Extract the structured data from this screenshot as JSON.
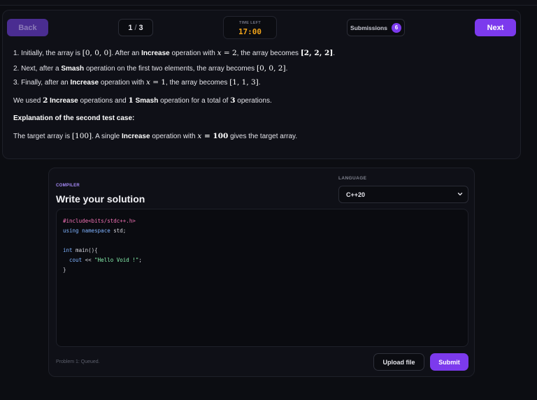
{
  "nav": {
    "back_label": "Back",
    "page_current": "1",
    "page_sep": "/",
    "page_total": "3",
    "time_left_label": "TIME LEFT",
    "time_left_value": "17:00",
    "submissions_label": "Submissions",
    "submissions_count": "6",
    "next_label": "Next"
  },
  "problem": {
    "step1": {
      "a": "1. Initially, the array is ",
      "m1": "[0, 0, 0]",
      "b": ". After an ",
      "op": "Increase",
      "c": " operation with ",
      "var": "x",
      "d": " = 2",
      "e": ", the array becomes ",
      "m2": "[2, 2, 2]",
      "f": "."
    },
    "step2": {
      "a": "2. Next, after a ",
      "op": "Smash",
      "b": " operation on the first two elements, the array becomes ",
      "m1": "[0, 0, 2]",
      "c": "."
    },
    "step3": {
      "a": "3. Finally, after an ",
      "op": "Increase",
      "b": " operation with ",
      "var": "x",
      "c": " = 1",
      "d": ", the array becomes ",
      "m1": "[1, 1, 3]",
      "e": "."
    },
    "summary": {
      "a": "We used ",
      "n1": "2",
      "op1": "Increase",
      "b": " operations and ",
      "n2": "1",
      "op2": "Smash",
      "c": " operation for a total of ",
      "n3": "3",
      "d": " operations."
    },
    "explanation_heading": "Explanation of the second test case:",
    "explanation": {
      "a": "The target array is ",
      "m1": "[100]",
      "b": ". A single ",
      "op": "Increase",
      "c": " operation with ",
      "var": "x",
      "d": " = 100",
      "e": " gives the target array."
    }
  },
  "compiler": {
    "tag": "COMPILER",
    "title": "Write your solution",
    "language_label": "LANGUAGE",
    "language_value": "C++20",
    "code": {
      "l1": "#include<bits/stdc++.h>",
      "l2_kw1": "using",
      "l2_kw2": "namespace",
      "l2_rest": " std;",
      "l4_kw": "int",
      "l4_rest": " main(){",
      "l5_kw": "  cout",
      "l5_mid": " << ",
      "l5_str": "\"Hello Void !\"",
      "l5_end": ";",
      "l6": "}"
    },
    "status_text": "Problem 1: Queued.",
    "upload_label": "Upload file",
    "submit_label": "Submit"
  },
  "colors": {
    "accent": "#7c3aed",
    "timer": "#f0a31a",
    "background": "#0c0d12"
  },
  "icons": {
    "language_dropdown": "chevron-down-icon"
  }
}
